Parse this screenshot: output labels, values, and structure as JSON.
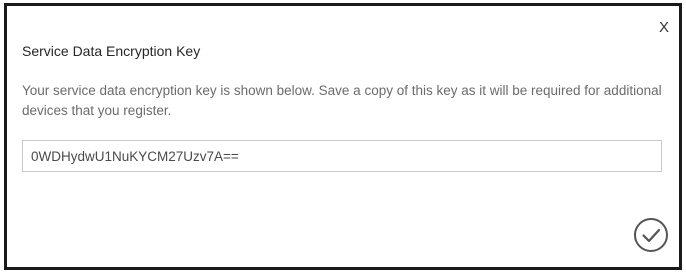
{
  "dialog": {
    "close_label": "X",
    "title": "Service Data Encryption Key",
    "description": "Your service data encryption key is shown below. Save a copy of this key as it will be required for additional devices that you register.",
    "key_value": "0WDHydwU1NuKYCM27Uzv7A==",
    "confirm_icon": "check-circle-icon"
  }
}
